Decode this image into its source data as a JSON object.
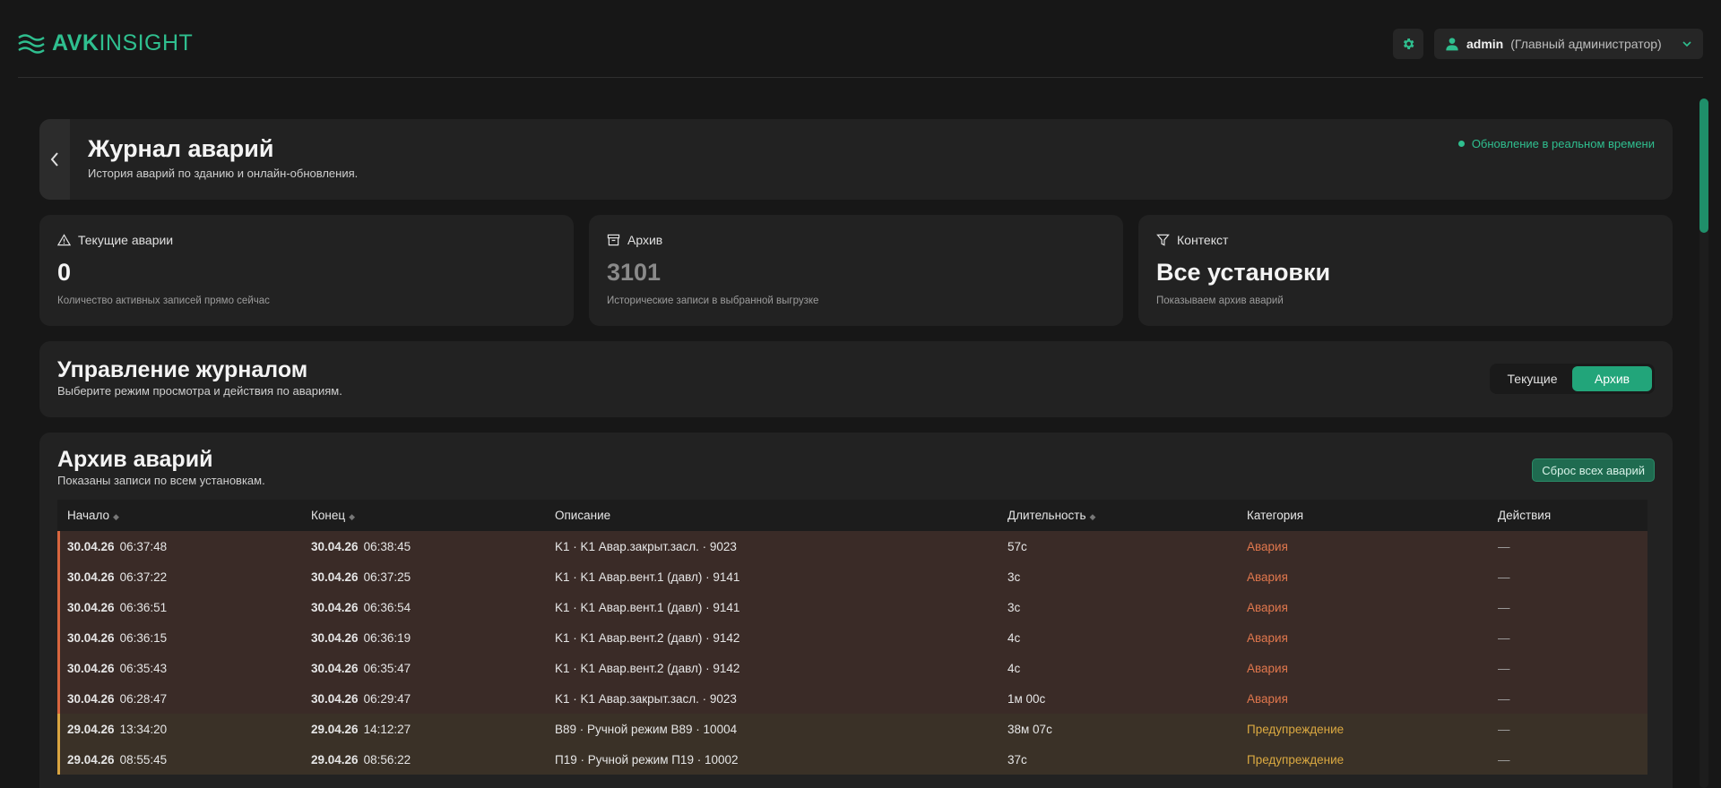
{
  "brand": {
    "part1": "AVK",
    "part2": "INSIGHT"
  },
  "user": {
    "name": "admin",
    "role": "(Главный администратор)"
  },
  "header": {
    "title": "Журнал аварий",
    "subtitle": "История аварий по зданию и онлайн-обновления.",
    "realtime": "Обновление в реальном времени"
  },
  "stats": [
    {
      "label": "Текущие аварии",
      "value": "0",
      "desc": "Количество активных записей прямо сейчас"
    },
    {
      "label": "Архив",
      "value": "3101",
      "desc": "Исторические записи в выбранной выгрузке"
    },
    {
      "label": "Контекст",
      "value": "Все установки",
      "desc": "Показываем архив аварий"
    }
  ],
  "control": {
    "title": "Управление журналом",
    "subtitle": "Выберите режим просмотра и действия по авариям.",
    "modes": [
      "Текущие",
      "Архив"
    ],
    "active_mode": "Архив"
  },
  "archive": {
    "title": "Архив аварий",
    "subtitle": "Показаны записи по всем установкам.",
    "reset_label": "Сброс всех аварий",
    "columns": [
      "Начало",
      "Конец",
      "Описание",
      "Длительность",
      "Категория",
      "Действия"
    ],
    "rows": [
      {
        "start_date": "30.04.26",
        "start_time": "06:37:48",
        "end_date": "30.04.26",
        "end_time": "06:38:45",
        "desc": "K1 · K1 Авар.закрыт.засл. · 9023",
        "duration": "57с",
        "category": "Авария",
        "action": "—"
      },
      {
        "start_date": "30.04.26",
        "start_time": "06:37:22",
        "end_date": "30.04.26",
        "end_time": "06:37:25",
        "desc": "K1 · K1 Авар.вент.1 (давл) · 9141",
        "duration": "3с",
        "category": "Авария",
        "action": "—"
      },
      {
        "start_date": "30.04.26",
        "start_time": "06:36:51",
        "end_date": "30.04.26",
        "end_time": "06:36:54",
        "desc": "K1 · K1 Авар.вент.1 (давл) · 9141",
        "duration": "3с",
        "category": "Авария",
        "action": "—"
      },
      {
        "start_date": "30.04.26",
        "start_time": "06:36:15",
        "end_date": "30.04.26",
        "end_time": "06:36:19",
        "desc": "K1 · K1 Авар.вент.2 (давл) · 9142",
        "duration": "4с",
        "category": "Авария",
        "action": "—"
      },
      {
        "start_date": "30.04.26",
        "start_time": "06:35:43",
        "end_date": "30.04.26",
        "end_time": "06:35:47",
        "desc": "K1 · K1 Авар.вент.2 (давл) · 9142",
        "duration": "4с",
        "category": "Авария",
        "action": "—"
      },
      {
        "start_date": "30.04.26",
        "start_time": "06:28:47",
        "end_date": "30.04.26",
        "end_time": "06:29:47",
        "desc": "K1 · K1 Авар.закрыт.засл. · 9023",
        "duration": "1м 00с",
        "category": "Авария",
        "action": "—"
      },
      {
        "start_date": "29.04.26",
        "start_time": "13:34:20",
        "end_date": "29.04.26",
        "end_time": "14:12:27",
        "desc": "В89 · Ручной режим В89 · 10004",
        "duration": "38м 07с",
        "category": "Предупреждение",
        "action": "—"
      },
      {
        "start_date": "29.04.26",
        "start_time": "08:55:45",
        "end_date": "29.04.26",
        "end_time": "08:56:22",
        "desc": "П19 · Ручной режим П19 · 10002",
        "duration": "37с",
        "category": "Предупреждение",
        "action": "—"
      }
    ]
  },
  "colors": {
    "accent": "#22a57a",
    "alarm": "#e0774d",
    "warning": "#dba941",
    "background": "#171717",
    "card": "#222222"
  },
  "icons": [
    "logo-waves-icon",
    "gear-icon",
    "user-icon",
    "chevron-down-icon",
    "chevron-left-icon",
    "warning-triangle-icon",
    "archive-box-icon",
    "filter-icon",
    "sort-icon"
  ]
}
